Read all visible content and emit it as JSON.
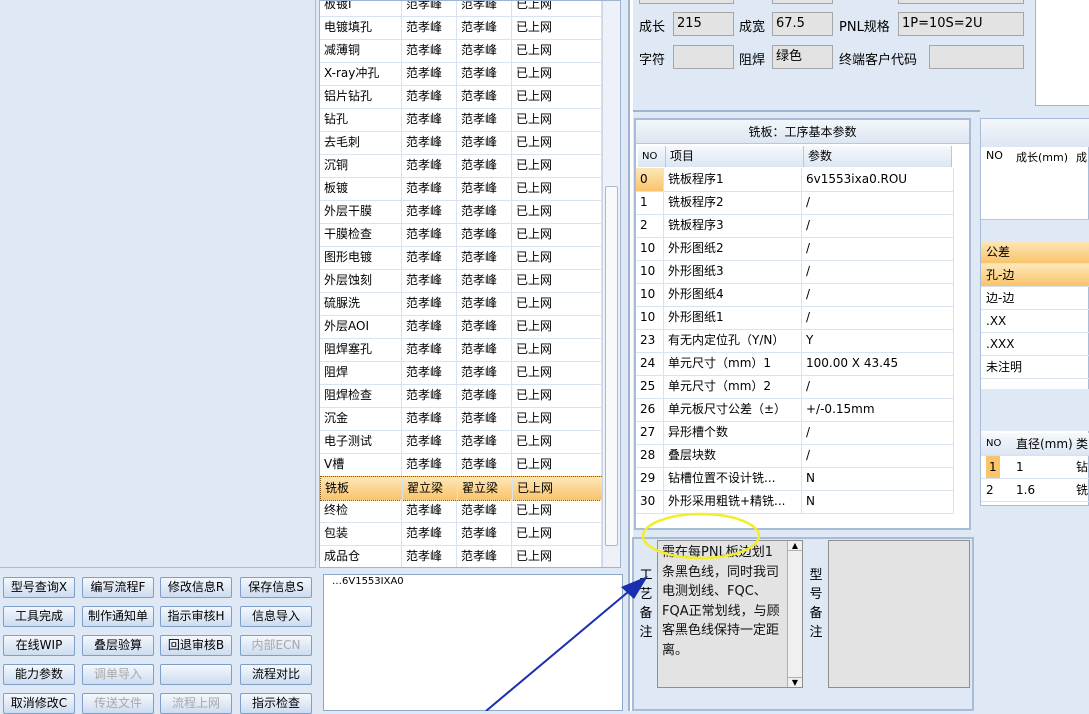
{
  "process_list": {
    "rows": [
      {
        "name": "板镀I",
        "c1": "范孝峰",
        "c2": "范孝峰",
        "c3": "已上网"
      },
      {
        "name": "电镀填孔",
        "c1": "范孝峰",
        "c2": "范孝峰",
        "c3": "已上网"
      },
      {
        "name": "减薄铜",
        "c1": "范孝峰",
        "c2": "范孝峰",
        "c3": "已上网"
      },
      {
        "name": "X-ray冲孔",
        "c1": "范孝峰",
        "c2": "范孝峰",
        "c3": "已上网"
      },
      {
        "name": "铝片钻孔",
        "c1": "范孝峰",
        "c2": "范孝峰",
        "c3": "已上网"
      },
      {
        "name": "钻孔",
        "c1": "范孝峰",
        "c2": "范孝峰",
        "c3": "已上网"
      },
      {
        "name": "去毛刺",
        "c1": "范孝峰",
        "c2": "范孝峰",
        "c3": "已上网"
      },
      {
        "name": "沉铜",
        "c1": "范孝峰",
        "c2": "范孝峰",
        "c3": "已上网"
      },
      {
        "name": "板镀",
        "c1": "范孝峰",
        "c2": "范孝峰",
        "c3": "已上网"
      },
      {
        "name": "外层干膜",
        "c1": "范孝峰",
        "c2": "范孝峰",
        "c3": "已上网"
      },
      {
        "name": "干膜检查",
        "c1": "范孝峰",
        "c2": "范孝峰",
        "c3": "已上网"
      },
      {
        "name": "图形电镀",
        "c1": "范孝峰",
        "c2": "范孝峰",
        "c3": "已上网"
      },
      {
        "name": "外层蚀刻",
        "c1": "范孝峰",
        "c2": "范孝峰",
        "c3": "已上网"
      },
      {
        "name": "硫脲洗",
        "c1": "范孝峰",
        "c2": "范孝峰",
        "c3": "已上网"
      },
      {
        "name": "外层AOI",
        "c1": "范孝峰",
        "c2": "范孝峰",
        "c3": "已上网"
      },
      {
        "name": "阻焊塞孔",
        "c1": "范孝峰",
        "c2": "范孝峰",
        "c3": "已上网"
      },
      {
        "name": "阻焊",
        "c1": "范孝峰",
        "c2": "范孝峰",
        "c3": "已上网"
      },
      {
        "name": "阻焊检查",
        "c1": "范孝峰",
        "c2": "范孝峰",
        "c3": "已上网"
      },
      {
        "name": "沉金",
        "c1": "范孝峰",
        "c2": "范孝峰",
        "c3": "已上网"
      },
      {
        "name": "电子测试",
        "c1": "范孝峰",
        "c2": "范孝峰",
        "c3": "已上网"
      },
      {
        "name": "V槽",
        "c1": "范孝峰",
        "c2": "范孝峰",
        "c3": "已上网"
      },
      {
        "name": "铣板",
        "c1": "翟立梁",
        "c2": "翟立梁",
        "c3": "已上网"
      },
      {
        "name": "终检",
        "c1": "范孝峰",
        "c2": "范孝峰",
        "c3": "已上网"
      },
      {
        "name": "包装",
        "c1": "范孝峰",
        "c2": "范孝峰",
        "c3": "已上网"
      },
      {
        "name": "成品仓",
        "c1": "范孝峰",
        "c2": "范孝峰",
        "c3": "已上网"
      }
    ]
  },
  "tree": {
    "node": "6V1553IXA0"
  },
  "buttons": [
    [
      "型号查询X",
      "编写流程F",
      "修改信息R",
      "保存信息S"
    ],
    [
      "工具完成",
      "制作通知单",
      "指示审核H",
      "信息导入"
    ],
    [
      "在线WIP",
      "叠层验算",
      "回退审核B",
      "内部ECN"
    ],
    [
      "能力参数",
      "调单导入",
      "",
      "流程对比"
    ],
    [
      "取消修改C",
      "传送文件",
      "流程上网",
      "指示检查"
    ]
  ],
  "info": {
    "len_label": "成长",
    "len_value": "215",
    "wid_label": "成宽",
    "wid_value": "67.5",
    "pnl_label": "PNL规格",
    "pnl_value": "1P=10S=2U",
    "char_label": "字符",
    "char_value": "",
    "mask_label": "阻焊",
    "mask_value": "绿色",
    "cust_label": "终端客户代码",
    "cust_value": ""
  },
  "mill": {
    "title": "铣板：工序基本参数",
    "headers": [
      "NO",
      "项目",
      "参数"
    ],
    "rows": [
      [
        "0",
        "铣板程序1",
        "6v1553ixa0.ROU"
      ],
      [
        "1",
        "铣板程序2",
        "/"
      ],
      [
        "2",
        "铣板程序3",
        "/"
      ],
      [
        "10",
        "外形图纸2",
        "/"
      ],
      [
        "10",
        "外形图纸3",
        "/"
      ],
      [
        "10",
        "外形图纸4",
        "/"
      ],
      [
        "10",
        "外形图纸1",
        "/"
      ],
      [
        "23",
        "有无内定位孔（Y/N）",
        "Y"
      ],
      [
        "24",
        "单元尺寸（mm）1",
        "100.00 X 43.45"
      ],
      [
        "25",
        "单元尺寸（mm）2",
        "/"
      ],
      [
        "26",
        "单元板尺寸公差（±）",
        "+/-0.15mm"
      ],
      [
        "27",
        "异形槽个数",
        "/"
      ],
      [
        "28",
        "叠层块数",
        "/"
      ],
      [
        "29",
        "钻槽位置不设计铣...",
        "N"
      ],
      [
        "30",
        "外形采用粗铣+精铣...",
        "N"
      ]
    ]
  },
  "notes": {
    "process_label": [
      "工",
      "艺",
      "备",
      "注"
    ],
    "process_text": "需在每PNL板边划1条黑色线，同时我司电测划线、FQC、FQA正常划线，与顾客黑色线保持一定距离。",
    "model_label": [
      "型",
      "号",
      "备",
      "注"
    ]
  },
  "right": {
    "hdr": [
      "NO",
      "成长(mm)",
      "成"
    ],
    "tol_header": "公差",
    "tol_rows": [
      "孔-边",
      "边-边",
      ".XX",
      ".XXX",
      "未注明"
    ],
    "hole_hdr": [
      "NO",
      "直径(mm)",
      "类"
    ],
    "hole_rows": [
      [
        "1",
        "1",
        "钻"
      ],
      [
        "2",
        "1.6",
        "铣"
      ]
    ]
  },
  "colors": {
    "selection": "#f9c46a",
    "annotation_circle": "#f2ee2a",
    "annotation_arrow": "#1a2fb0"
  }
}
